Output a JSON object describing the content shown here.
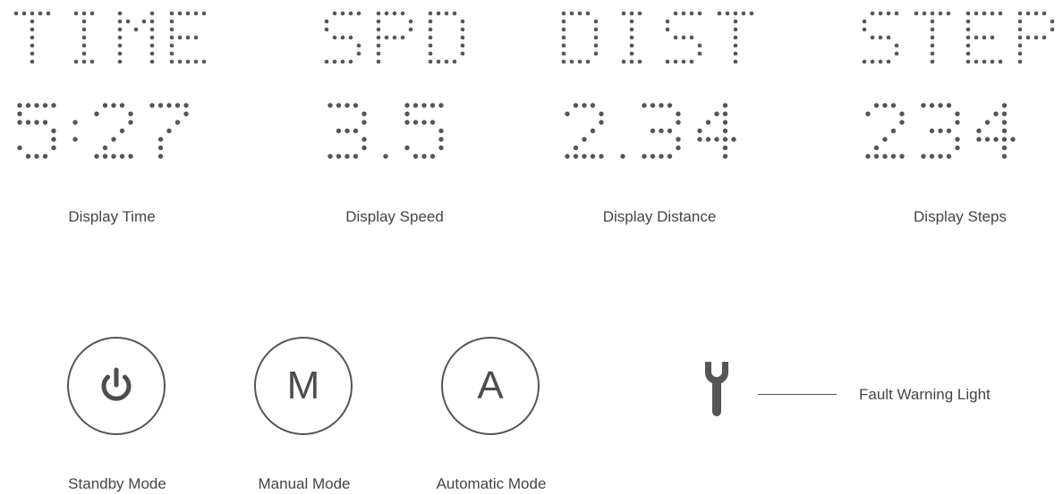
{
  "display": {
    "time": {
      "top_text": "TIME",
      "value": "5:27",
      "caption": "Display Time"
    },
    "speed": {
      "top_text": "SPD",
      "value": "3.5",
      "caption": "Display Speed"
    },
    "distance": {
      "top_text": "DIST",
      "value": "2.34",
      "caption": "Display Distance"
    },
    "steps": {
      "top_text": "STEP",
      "value": "234",
      "caption": "Display Steps"
    }
  },
  "modes": {
    "standby": {
      "caption": "Standby Mode",
      "icon": "power-icon"
    },
    "manual": {
      "caption": "Manual Mode",
      "letter": "M"
    },
    "automatic": {
      "caption": "Automatic Mode",
      "letter": "A"
    }
  },
  "fault": {
    "label": "Fault Warning Light",
    "icon": "wrench-icon"
  },
  "colors": {
    "dot": "#555555",
    "outline": "#555555",
    "text": "#444444"
  }
}
